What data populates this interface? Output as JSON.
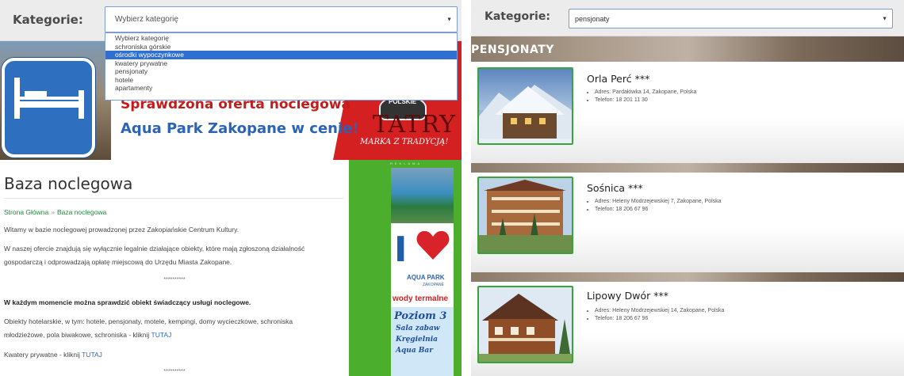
{
  "left": {
    "category_label": "Kategorie:",
    "select_value": "Wybierz kategorię",
    "dropdown_options": [
      {
        "label": "Wybierz kategorię",
        "selected": false
      },
      {
        "label": "schroniska górskie",
        "selected": false
      },
      {
        "label": "ośrodki wypoczynkowe",
        "selected": true
      },
      {
        "label": "kwatery prywatne",
        "selected": false
      },
      {
        "label": "pensjonaty",
        "selected": false
      },
      {
        "label": "hotele",
        "selected": false
      },
      {
        "label": "apartamenty",
        "selected": false
      }
    ],
    "banner": {
      "line1": "Sprawdzona oferta noclegowa",
      "line2": "Aqua Park Zakopane w cenie!",
      "badge": "POLSKIE",
      "logo": "TATRY",
      "slogan": "MARKA Z TRADYCJĄ!"
    },
    "page_title": "Baza noclegowa",
    "breadcrumb": {
      "home": "Strona Główna",
      "separator": "»",
      "current": "Baza noclegowa"
    },
    "para1": "Witamy w bazie noclegowej prowadzonej przez Zakopiańskie Centrum Kultury.",
    "para2a": "W naszej ofercie znajdują się wyłącznie legalnie działające obiekty, które mają zgłoszoną działalność",
    "para2b": "gospodarczą i odprowadzają opłatę miejscową do Urzędu Miasta Zakopane.",
    "stars": "**********",
    "para3": "W każdym momencie można sprawdzić obiekt świadczący usługi noclegowe.",
    "para4a": "Obiekty hotelarskie, w tym: hotele, pensjonaty, motele, kempingi, domy wycieczkowe, schroniska",
    "para4b_text": "młodzieżowe, pola biwakowe, schroniska - kliknij",
    "para4b_link": "TUTAJ",
    "para5_text": "Kwatery prywatne - kliknij",
    "para5_link": "TUTAJ",
    "reklama": "REKLAMA",
    "ad": {
      "letter": "I",
      "aqua": "AQUA PARK",
      "zakopane": "ZAKOPANE",
      "wody": "wody termalne",
      "poziom": "Poziom 3",
      "line1": "Sala zabaw",
      "line2": "Kręgielnia",
      "line3": "Aqua Bar"
    }
  },
  "right": {
    "category_label": "Kategorie:",
    "select_value": "pensjonaty",
    "section_title": "PENSJONATY",
    "listings": [
      {
        "name": "Orla Perć ***",
        "address": "Adres: Pardałówka 14, Zakopane, Polska",
        "phone": "Telefon: 18 201 11 30"
      },
      {
        "name": "Sośnica ***",
        "address": "Adres: Heleny Modrzejewskiej 7, Zakopane, Polska",
        "phone": "Telefon: 18 206 67 96"
      },
      {
        "name": "Lipowy Dwór ***",
        "address": "Adres: Heleny Modrzejewskiej 14, Zakopane, Polska",
        "phone": "Telefon: 18 206 67 96"
      }
    ]
  },
  "colors": {
    "accent_blue": "#2f6fd0",
    "green": "#4bae2c",
    "link": "#2c6bc4",
    "banner_red": "#d42020"
  }
}
